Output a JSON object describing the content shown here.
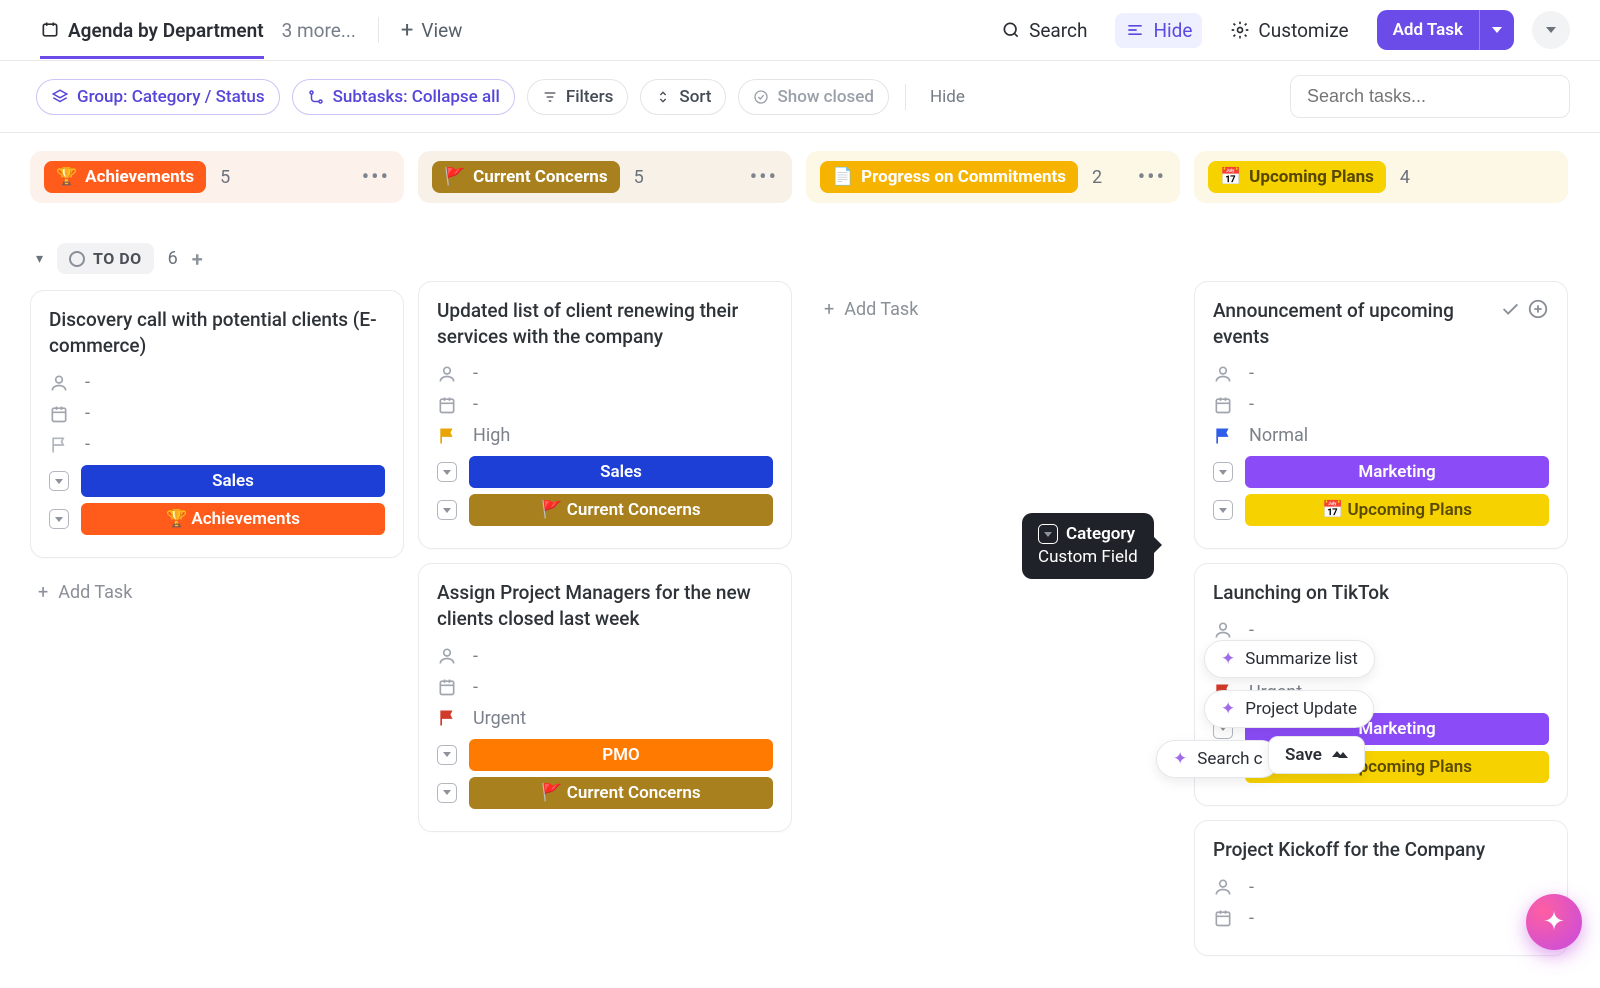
{
  "topbar": {
    "view_name": "Agenda by Department",
    "more_views": "3 more...",
    "add_view": "View",
    "search": "Search",
    "hide": "Hide",
    "customize": "Customize",
    "add_task": "Add Task"
  },
  "toolbar": {
    "group": "Group: Category / Status",
    "subtasks": "Subtasks: Collapse all",
    "filters": "Filters",
    "sort": "Sort",
    "show_closed": "Show closed",
    "hide": "Hide",
    "search_placeholder": "Search tasks..."
  },
  "status": {
    "label": "TO DO",
    "count": "6"
  },
  "tooltip": {
    "line1": "Category",
    "line2": "Custom Field"
  },
  "ai": {
    "summarize": "Summarize list",
    "update": "Project Update",
    "search": "Search c",
    "save": "Save"
  },
  "columns": [
    {
      "badge_emoji": "🏆",
      "badge_text": "Achievements",
      "badge_class": "orange",
      "header_class": "orange",
      "count": "5",
      "show_more": true,
      "show_status_row": true,
      "empty_add": false,
      "cards": [
        {
          "title": "Discovery call with potential clients (E-commerce)",
          "assignee": "-",
          "date": "-",
          "priority_label": "-",
          "priority_flag": "gray",
          "tags": [
            {
              "text": "Sales",
              "class": "blue"
            },
            {
              "text": "🏆 Achievements",
              "class": "orange"
            }
          ],
          "show_actions": false
        }
      ],
      "trailing_add": true
    },
    {
      "badge_emoji": "🚩",
      "badge_text": "Current Concerns",
      "badge_class": "tan",
      "header_class": "tan",
      "count": "5",
      "show_more": true,
      "show_status_row": false,
      "empty_add": false,
      "cards": [
        {
          "title": "Updated list of client renewing their services with the company",
          "assignee": "-",
          "date": "-",
          "priority_label": "High",
          "priority_flag": "yellow",
          "tags": [
            {
              "text": "Sales",
              "class": "blue"
            },
            {
              "text": "🚩 Current Concerns",
              "class": "tan"
            }
          ],
          "show_actions": false
        },
        {
          "title": "Assign Project Managers for the new clients closed last week",
          "assignee": "-",
          "date": "-",
          "priority_label": "Urgent",
          "priority_flag": "red",
          "tags": [
            {
              "text": "PMO",
              "class": "darkorange"
            },
            {
              "text": "🚩 Current Concerns",
              "class": "tan"
            }
          ],
          "show_actions": false
        }
      ],
      "trailing_add": false
    },
    {
      "badge_emoji": "📄",
      "badge_text": "Progress on Commitments",
      "badge_class": "gold",
      "header_class": "yellow",
      "count": "2",
      "show_more": true,
      "show_status_row": false,
      "empty_add": true,
      "cards": [],
      "trailing_add": false
    },
    {
      "badge_emoji": "📅",
      "badge_text": "Upcoming Plans",
      "badge_class": "amber",
      "header_class": "yellow",
      "count": "4",
      "show_more": false,
      "show_status_row": false,
      "empty_add": false,
      "cards": [
        {
          "title": "Announcement of upcoming events",
          "assignee": "-",
          "date": "-",
          "priority_label": "Normal",
          "priority_flag": "blue",
          "tags": [
            {
              "text": "Marketing",
              "class": "purple"
            },
            {
              "text": "📅 Upcoming Plans",
              "class": "yellow"
            }
          ],
          "show_actions": true
        },
        {
          "title": "Launching on TikTok",
          "assignee": "-",
          "date": "-",
          "priority_label": "Urgent",
          "priority_flag": "red",
          "tags": [
            {
              "text": "Marketing",
              "class": "purple"
            },
            {
              "text": "📅 Upcoming Plans",
              "class": "yellow"
            }
          ],
          "show_actions": false
        },
        {
          "title": "Project Kickoff for the Company",
          "assignee": "-",
          "date": "-",
          "priority_label": "",
          "priority_flag": "gray",
          "tags": [],
          "show_actions": false
        }
      ],
      "trailing_add": false
    }
  ],
  "add_task_label": "Add Task"
}
